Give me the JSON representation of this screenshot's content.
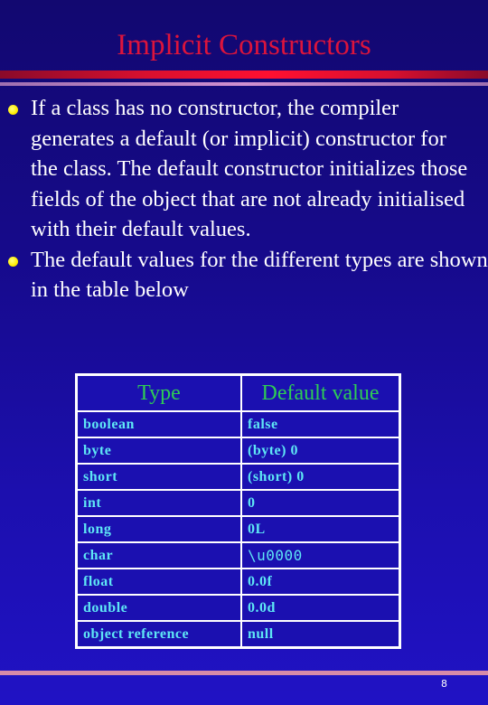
{
  "slide": {
    "title": "Implicit Constructors",
    "bullets": [
      {
        "text": "If a class has no constructor, the compiler generates a default (or implicit) constructor for the class.  The default constructor initializes those fields of the object that are not already initialised with their default values.",
        "icon": "yellow-dot-bullet"
      },
      {
        "text": "The default values for the different types are shown in the table below",
        "icon": "yellow-dot-bullet"
      }
    ],
    "table": {
      "headers": [
        "Type",
        "Default value"
      ],
      "rows": [
        [
          "boolean",
          "false"
        ],
        [
          "byte",
          "(byte) 0"
        ],
        [
          "short",
          "(short) 0"
        ],
        [
          "int",
          "0"
        ],
        [
          "long",
          "0L"
        ],
        [
          "char",
          "\\u0000"
        ],
        [
          "float",
          "0.0f"
        ],
        [
          "double",
          "0.0d"
        ],
        [
          "object reference",
          "null"
        ]
      ]
    },
    "page_number": "8"
  },
  "colors": {
    "title": "#dc143c",
    "header_text": "#2ecc55",
    "cell_text": "#5ee6f5",
    "bullet": "#ffee00",
    "background_top": "#120870",
    "background_bottom": "#2012c4"
  }
}
